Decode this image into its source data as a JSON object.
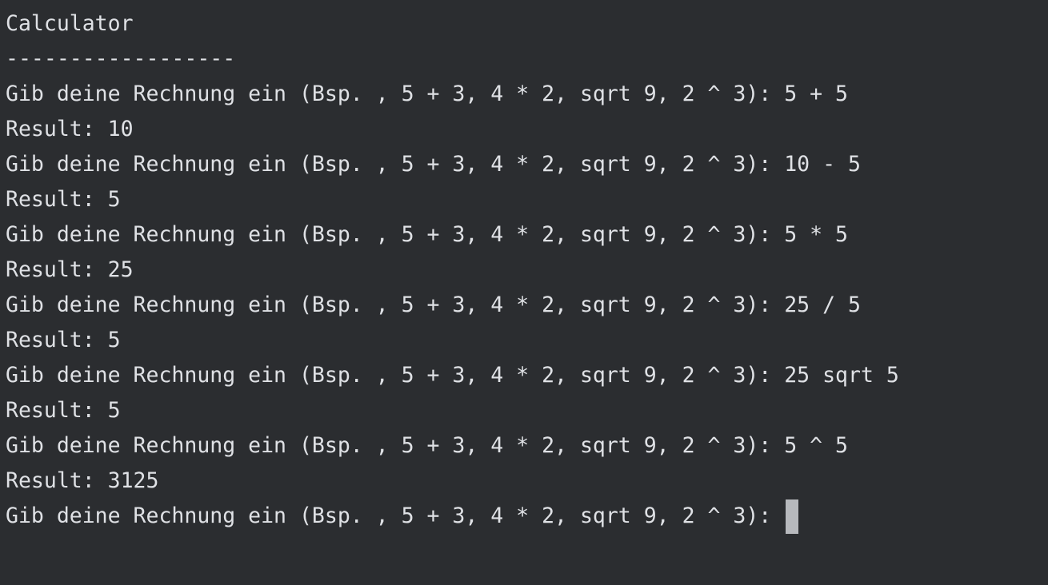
{
  "console": {
    "title": "Calculator",
    "separator": "------------------",
    "prompt": "Gib deine Rechnung ein (Bsp. , 5 + 3, 4 * 2, sqrt 9, 2 ^ 3): ",
    "entries": [
      {
        "input": "5 + 5",
        "result": "Result: 10"
      },
      {
        "input": "10 - 5",
        "result": "Result: 5"
      },
      {
        "input": "5 * 5",
        "result": "Result: 25"
      },
      {
        "input": "25 / 5",
        "result": "Result: 5"
      },
      {
        "input": "25 sqrt 5",
        "result": "Result: 5"
      },
      {
        "input": "5 ^ 5",
        "result": "Result: 3125"
      }
    ],
    "current_input": ""
  }
}
